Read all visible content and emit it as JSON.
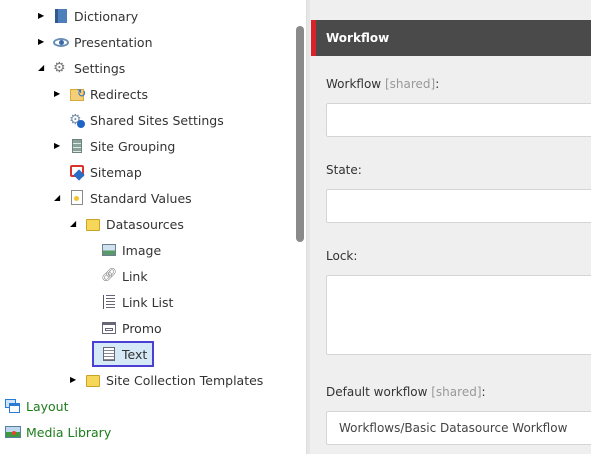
{
  "tree": {
    "items": [
      {
        "label": "Dictionary",
        "icon": "book-icon",
        "expander": "collapsed"
      },
      {
        "label": "Presentation",
        "icon": "eye-icon",
        "expander": "collapsed"
      },
      {
        "label": "Settings",
        "icon": "gears-icon",
        "expander": "expanded"
      },
      {
        "label": "Redirects",
        "icon": "redirect-folder-icon",
        "expander": "collapsed"
      },
      {
        "label": "Shared Sites Settings",
        "icon": "settings-info-icon",
        "expander": "none"
      },
      {
        "label": "Site Grouping",
        "icon": "list-stack-icon",
        "expander": "collapsed"
      },
      {
        "label": "Sitemap",
        "icon": "sitemap-icon",
        "expander": "none"
      },
      {
        "label": "Standard Values",
        "icon": "document-icon",
        "expander": "expanded"
      },
      {
        "label": "Datasources",
        "icon": "folder-icon",
        "expander": "expanded"
      },
      {
        "label": "Image",
        "icon": "image-icon",
        "expander": "none"
      },
      {
        "label": "Link",
        "icon": "link-icon",
        "expander": "none"
      },
      {
        "label": "Link List",
        "icon": "list-icon",
        "expander": "none"
      },
      {
        "label": "Promo",
        "icon": "promo-icon",
        "expander": "none"
      },
      {
        "label": "Text",
        "icon": "text-icon",
        "expander": "none",
        "selected": true
      },
      {
        "label": "Site Collection Templates",
        "icon": "folder-icon",
        "expander": "collapsed"
      },
      {
        "label": "Layout",
        "icon": "layout-icon",
        "expander": "none"
      },
      {
        "label": "Media Library",
        "icon": "media-library-icon",
        "expander": "none"
      }
    ]
  },
  "panel": {
    "section_title": "Workflow",
    "accent": "#d6232a",
    "fields": [
      {
        "label": "Workflow",
        "shared": "[shared]",
        "suffix": ":",
        "value": ""
      },
      {
        "label": "State:",
        "value": ""
      },
      {
        "label": "Lock:",
        "value": ""
      },
      {
        "label": "Default workflow",
        "shared": "[shared]",
        "suffix": ":",
        "value": "Workflows/Basic Datasource Workflow"
      }
    ]
  }
}
